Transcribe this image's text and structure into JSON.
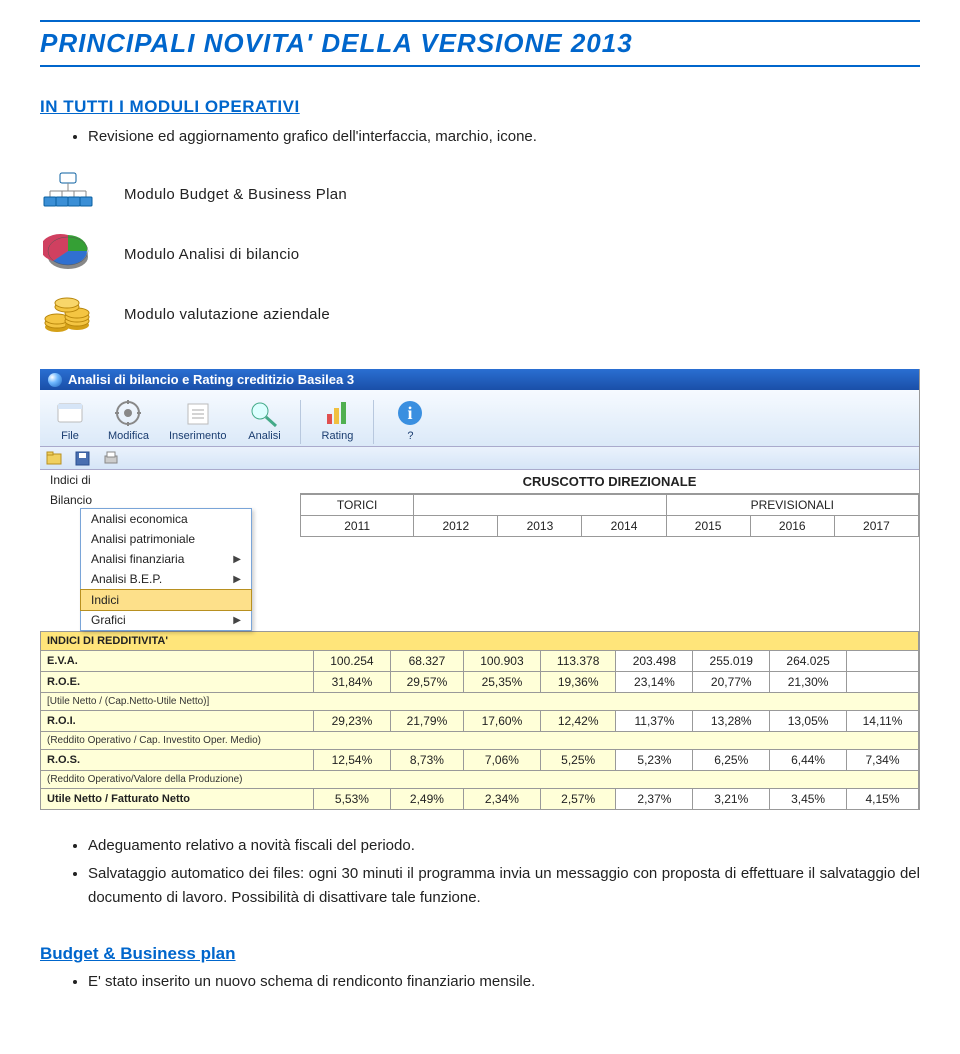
{
  "page_title": "PRINCIPALI NOVITA' DELLA VERSIONE 2013",
  "intro_section_title": "IN TUTTI I MODULI OPERATIVI",
  "intro_bullet": "Revisione ed aggiornamento grafico dell'interfaccia, marchio, icone.",
  "modules": {
    "budget": "Modulo Budget & Business Plan",
    "analisi": "Modulo Analisi di bilancio",
    "valutazione": "Modulo valutazione aziendale"
  },
  "screenshot": {
    "app_title": "Analisi di bilancio e Rating creditizio Basilea 3",
    "toolbar": {
      "file": "File",
      "modifica": "Modifica",
      "inserimento": "Inserimento",
      "analisi": "Analisi",
      "rating": "Rating",
      "help": "?"
    },
    "left_rows": {
      "indici_di": "Indici di",
      "bilancio": "Bilancio"
    },
    "dropdown": {
      "items": [
        "Analisi economica",
        "Analisi patrimoniale",
        "Analisi finanziaria",
        "Analisi B.E.P.",
        "Indici",
        "Grafici"
      ]
    },
    "cruscotto_title": "CRUSCOTTO DIREZIONALE",
    "header_groups": {
      "storici": "TORICI",
      "prev": "PREVISIONALI"
    },
    "years": [
      "2011",
      "2012",
      "2013",
      "2014",
      "2015",
      "2016",
      "2017"
    ],
    "section_header": "INDICI DI REDDITIVITA'",
    "rows": [
      {
        "label": "E.V.A.",
        "sub": "",
        "vals": [
          "100.254",
          "68.327",
          "100.903",
          "113.378",
          "203.498",
          "255.019",
          "264.025"
        ]
      },
      {
        "label": "R.O.E.",
        "sub": "[Utile Netto / (Cap.Netto-Utile Netto)]",
        "vals": [
          "31,84%",
          "29,57%",
          "25,35%",
          "19,36%",
          "23,14%",
          "20,77%",
          "21,30%"
        ]
      },
      {
        "label": "R.O.I.",
        "sub": "(Reddito Operativo / Cap. Investito Oper. Medio)",
        "vals": [
          "29,23%",
          "21,79%",
          "17,60%",
          "12,42%",
          "11,37%",
          "13,28%",
          "13,05%",
          "14,11%"
        ]
      },
      {
        "label": "R.O.S.",
        "sub": "(Reddito Operativo/Valore della Produzione)",
        "vals": [
          "12,54%",
          "8,73%",
          "7,06%",
          "5,25%",
          "5,23%",
          "6,25%",
          "6,44%",
          "7,34%"
        ]
      },
      {
        "label": "Utile Netto / Fatturato Netto",
        "sub": "",
        "vals": [
          "5,53%",
          "2,49%",
          "2,34%",
          "2,57%",
          "2,37%",
          "3,21%",
          "3,45%",
          "4,15%"
        ]
      }
    ]
  },
  "post_bullets": {
    "b1": "Adeguamento relativo a novità fiscali del periodo.",
    "b2": "Salvataggio automatico dei files: ogni 30 minuti il programma invia un messaggio con proposta di effettuare il salvataggio del documento di lavoro. Possibilità di disattivare tale funzione."
  },
  "budget_section": {
    "title": "Budget & Business plan",
    "bullet": "E' stato inserito un nuovo schema di rendiconto finanziario mensile."
  }
}
